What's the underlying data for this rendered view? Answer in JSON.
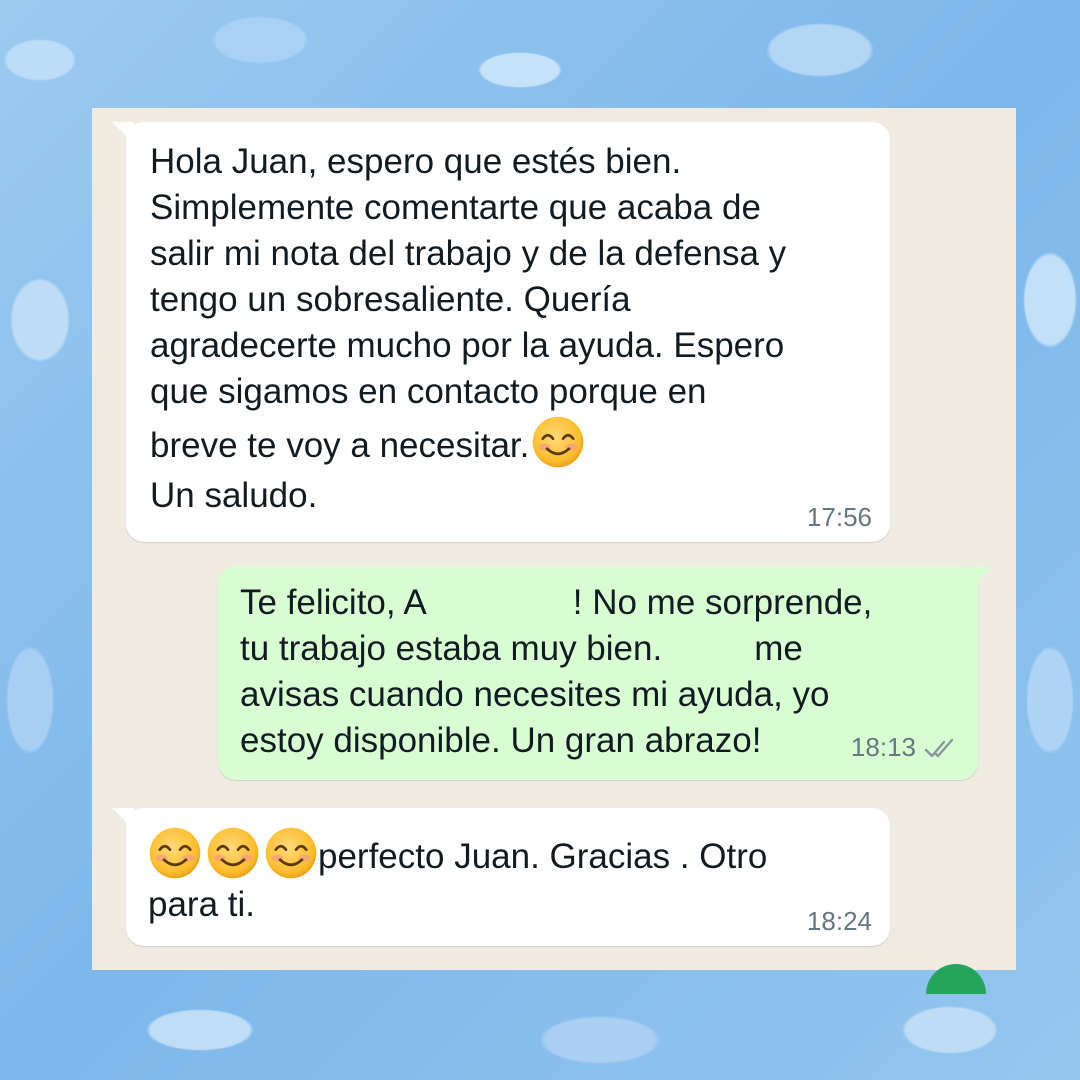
{
  "colors": {
    "page_background": "#8ec1ee",
    "chat_background": "#efeae2",
    "incoming_bubble": "#ffffff",
    "outgoing_bubble": "#d9fdd3",
    "timestamp": "#667781",
    "read_ticks": "#8696a0"
  },
  "messages": [
    {
      "direction": "incoming",
      "lines": [
        "Hola Juan, espero que estés bien.",
        "Simplemente comentarte que acaba de",
        "salir mi nota del trabajo y de la defensa y",
        "tengo un sobresaliente. Quería",
        "agradecerte mucho por la ayuda. Espero",
        "que sigamos en contacto porque en",
        "breve te voy a necesitar.",
        "Un saludo."
      ],
      "emoji": "smiling-face-icon",
      "time": "17:56"
    },
    {
      "direction": "outgoing",
      "line1_a": "Te felicito, A",
      "line1_b": "! No me sorprende,",
      "line2_a": "tu trabajo estaba muy bien.",
      "line2_b": "me",
      "line3": "avisas cuando necesites mi ayuda, yo",
      "line4": "estoy disponible. Un gran abrazo!",
      "time": "18:13",
      "status_icon": "double-check-icon"
    },
    {
      "direction": "incoming",
      "emoji": "smiling-face-icon",
      "emoji_count": 3,
      "line1": "perfecto Juan. Gracias . Otro",
      "line2": "para ti.",
      "time": "18:24"
    }
  ]
}
